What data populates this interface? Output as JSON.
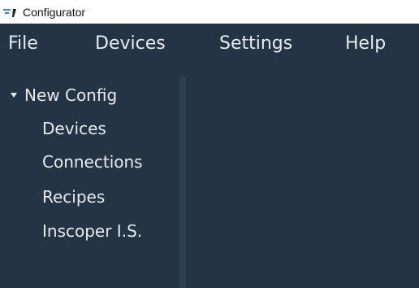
{
  "window": {
    "title": "Configurator",
    "icon": "configurator-logo-icon"
  },
  "menubar": {
    "items": [
      "File",
      "Devices",
      "Settings",
      "Help"
    ]
  },
  "tree": {
    "root": {
      "label": "New Config",
      "expanded": true,
      "children": [
        "Devices",
        "Connections",
        "Recipes",
        "Inscoper I.S."
      ]
    }
  },
  "colors": {
    "background": "#253444",
    "text": "#e6ebef",
    "titlebar": "#ffffff",
    "splitter": "#2c4052",
    "icon_accent": "#2a8fc4"
  }
}
